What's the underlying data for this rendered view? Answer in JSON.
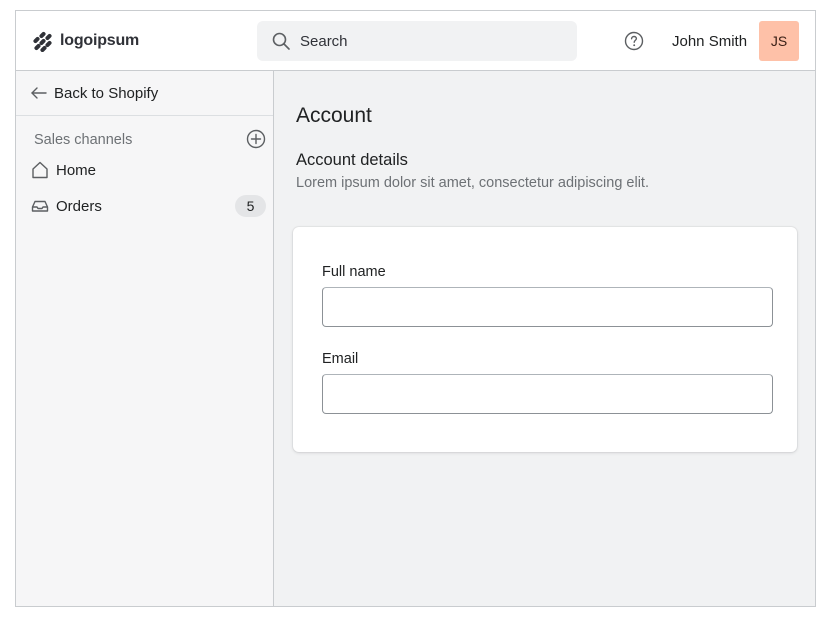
{
  "header": {
    "logo_text": "logoipsum",
    "search_placeholder": "Search",
    "user_name": "John Smith",
    "user_initials": "JS",
    "avatar_color": "#fec1a8"
  },
  "sidebar": {
    "back_label": "Back to Shopify",
    "section_title": "Sales channels",
    "items": [
      {
        "label": "Home",
        "icon": "home-icon"
      },
      {
        "label": "Orders",
        "icon": "inbox-icon",
        "badge": "5"
      }
    ]
  },
  "main": {
    "page_title": "Account",
    "section_heading": "Account details",
    "section_description": "Lorem ipsum dolor sit amet, consectetur adipiscing elit.",
    "form": {
      "fields": [
        {
          "label": "Full name",
          "value": ""
        },
        {
          "label": "Email",
          "value": ""
        }
      ]
    }
  }
}
